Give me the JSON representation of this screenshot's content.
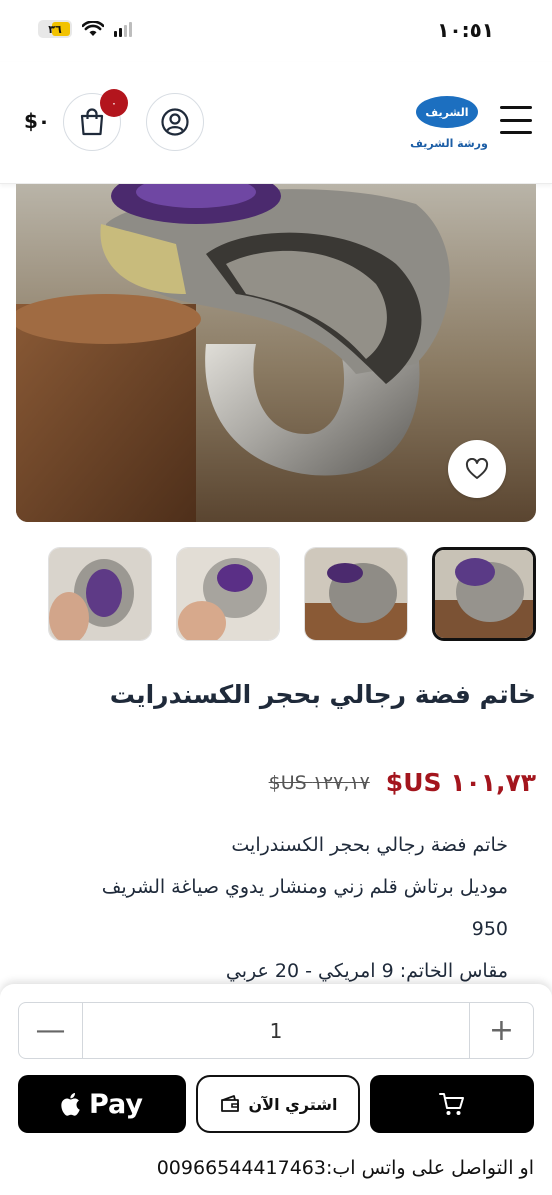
{
  "status_bar": {
    "time": "١٠:٥١",
    "battery": "٣٦",
    "battery_fraction": 0.36
  },
  "header": {
    "logo_text_top": "الشريف",
    "logo_text_bottom": "ورشة الشريف",
    "cart_count": "٠",
    "cart_total": "$٠"
  },
  "product": {
    "title": "خاتم فضة رجالي بحجر الكسندرايت",
    "old_price": "$US ١٢٧,١٧",
    "new_price": "$US ١٠١,٧٣",
    "description": [
      "خاتم فضة رجالي بحجر الكسندرايت",
      "موديل برتاش قلم زني ومنشار يدوي صياغة الشريف",
      "950",
      "مقاس الخاتم: 9 امريكي - 20 عربي"
    ],
    "thumbnail_count": 4,
    "active_thumbnail": 1
  },
  "purchase": {
    "quantity": "1",
    "minus_symbol": "—",
    "plus_symbol": "+",
    "apple_pay_label": "Pay",
    "buy_now_label": "اشتري الآن",
    "contact_text": "او التواصل على واتس اب:00966544417463"
  },
  "colors": {
    "price_red": "#a3151d",
    "badge_red": "#b3151d",
    "logo_blue": "#1c6fc0"
  }
}
